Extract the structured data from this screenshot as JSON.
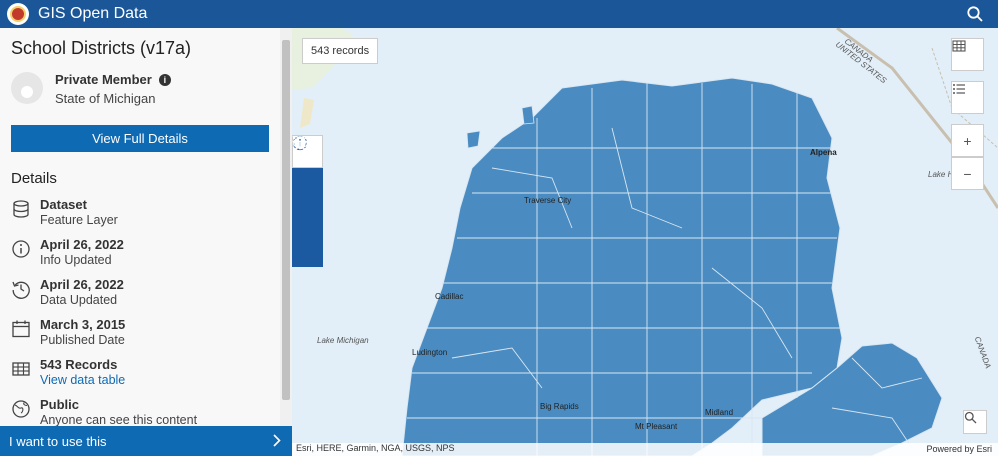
{
  "header": {
    "title": "GIS Open Data",
    "logo": "state-seal",
    "search_icon": "search-icon"
  },
  "sidebar": {
    "title": "School Districts (v17a)",
    "owner": {
      "name": "Private Member",
      "org": "State of Michigan"
    },
    "view_details_label": "View Full Details",
    "details_heading": "Details",
    "details": [
      {
        "icon": "database-icon",
        "main": "Dataset",
        "sub": "Feature Layer"
      },
      {
        "icon": "info-icon",
        "main": "April 26, 2022",
        "sub": "Info Updated"
      },
      {
        "icon": "history-icon",
        "main": "April 26, 2022",
        "sub": "Data Updated"
      },
      {
        "icon": "calendar-icon",
        "main": "March 3, 2015",
        "sub": "Published Date"
      },
      {
        "icon": "table-icon",
        "main": "543 Records",
        "link": "View data table"
      },
      {
        "icon": "globe-icon",
        "main": "Public",
        "sub": "Anyone can see this content"
      }
    ],
    "use_label": "I want to use this"
  },
  "map": {
    "records_badge": "543 records",
    "tools": [
      "info-icon",
      "filter-icon",
      "download-icon",
      "star-icon"
    ],
    "right_buttons": [
      "table-view-icon",
      "list-view-icon"
    ],
    "zoom_in": "+",
    "zoom_out": "−",
    "labels": {
      "canada": "CANADA",
      "united_states": "UNITED STATES",
      "alpena": "Alpena",
      "traverse_city": "Traverse City",
      "lake_huron": "Lake H",
      "cadillac": "Cadillac",
      "lake_michigan": "Lake Michigan",
      "ludington": "Ludington",
      "midland": "Midland",
      "big_rapids": "Big Rapids",
      "mt_pleasant": "Mt Pleasant",
      "canada_right": "CANADA"
    },
    "attribution": "Esri, HERE, Garmin, NGA, USGS, NPS",
    "powered_by": "Powered by Esri",
    "colors": {
      "districts": "#4a8cc2",
      "water": "#e2eff8",
      "boundaries": "#d8e6f2"
    }
  }
}
